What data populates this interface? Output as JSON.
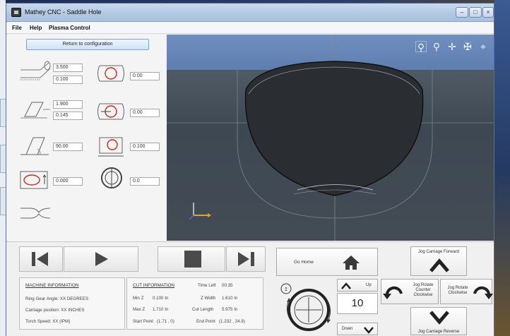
{
  "window": {
    "title": "Mathey CNC - Saddle Hole"
  },
  "menu": [
    "File",
    "Help",
    "Plasma Control"
  ],
  "left_panel": {
    "return_label": "Return to configuration",
    "fields": {
      "pipe_diameter": "3.500",
      "pipe_wall": "0.100",
      "branch_diameter": "1.900",
      "branch_wall": "0.145",
      "angle": "90.00",
      "offset_a": "0.000",
      "hole_a": "0.00",
      "hole_b": "0.00",
      "hole_c": "0.100",
      "rotation": "0.0"
    }
  },
  "controls": {
    "go_home": "Go Home",
    "up": "Up",
    "down": "Down",
    "step": "10",
    "jog_forward": "Jog Carriage Forward",
    "jog_reverse": "Jog Carriage Reverse",
    "jog_ccw": "Jog Rotate Counter Clockwise",
    "jog_cw": "Jog Rotate Clockwise"
  },
  "machine_info": {
    "title": "MACHINE INFORMATION",
    "ring_gear": "Ring Gear Angle: XX DEGREES",
    "carriage": "Carriage position: XX INCHES",
    "torch": "Torch Speed: XX (IPM)"
  },
  "cut_info": {
    "title": "CUT INFORMATION",
    "time_left_label": "Time Left",
    "time_left": "00:35",
    "min_z_label": "Min Z",
    "min_z": "0.100 In",
    "z_width_label": "Z Width",
    "z_width": "1.610 In",
    "max_z_label": "Max Z",
    "max_z": "1.710 In",
    "cut_length_label": "Cut Length",
    "cut_length": "5.975 In",
    "start_point_label": "Start Point",
    "start_point": "(1.71 , 0)",
    "end_point_label": "End Point",
    "end_point": "(1.232 , 24.9)"
  },
  "colors": {
    "accent": "#5f7eb0",
    "viewport": "#434c55",
    "button_glyph": "#4a4a4a",
    "red_circle": "#cc2a1c"
  }
}
